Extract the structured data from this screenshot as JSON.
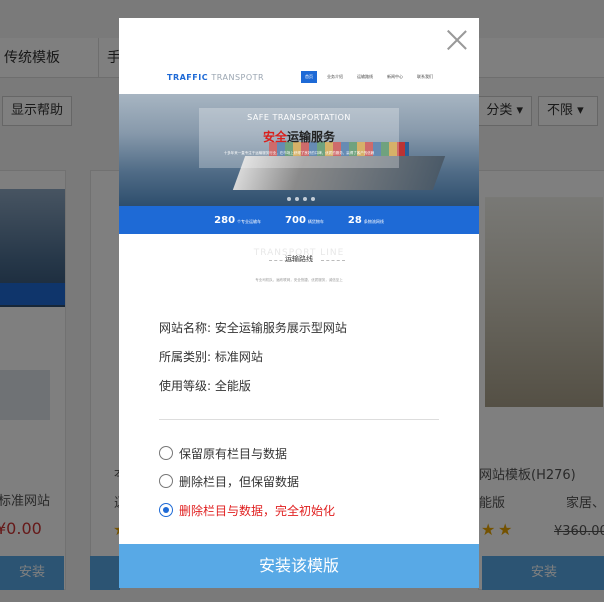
{
  "background": {
    "tabs": [
      "传统模板",
      "手"
    ],
    "help_button": "显示帮助",
    "category_button": "分类",
    "limit_button": "不限",
    "card_left": {
      "text1": "标准网站",
      "price": "¥0.00",
      "install": "安装"
    },
    "card_mid": {
      "text1": "夲",
      "text2": "逗"
    },
    "card_right": {
      "title": "网站模板(H276)",
      "meta_left": "能版",
      "meta_right": "家居、",
      "price": "¥360.00",
      "install": "安装"
    }
  },
  "modal": {
    "preview": {
      "logo_a": "TRAFFIC",
      "logo_b": "TRANSPOTR",
      "menu": [
        "首页",
        "业务介绍",
        "运输路线",
        "新闻中心",
        "联系我们"
      ],
      "hero_en": "SAFE TRANSPORTATION",
      "hero_cn_red": "安全",
      "hero_cn_rest": "运输服务",
      "hero_desc": "十多年来一直专注于运输服务行业，在市场上获得了良好的口碑，优质的服务，赢得了客户的信赖",
      "stats": [
        {
          "n": "280",
          "u": "个专业运输车"
        },
        {
          "n": "700",
          "u": "辆货物车"
        },
        {
          "n": "28",
          "u": "条物流网线"
        }
      ],
      "line_ghost": "TRANSPORT LINE",
      "line_main": "运输路线",
      "line_sub": "专业司机队，遍布联网，安全快捷，优质服务，诚信至上"
    },
    "info": {
      "name_label": "网站名称: 安全运输服务展示型网站",
      "category_label": "所属类别: 标准网站",
      "level_label": "使用等级: 全能版"
    },
    "options": [
      {
        "label": "保留原有栏目与数据",
        "checked": false
      },
      {
        "label": "删除栏目，但保留数据",
        "checked": false
      },
      {
        "label": "删除栏目与数据，完全初始化",
        "checked": true
      }
    ],
    "install_label": "安装该模版"
  }
}
